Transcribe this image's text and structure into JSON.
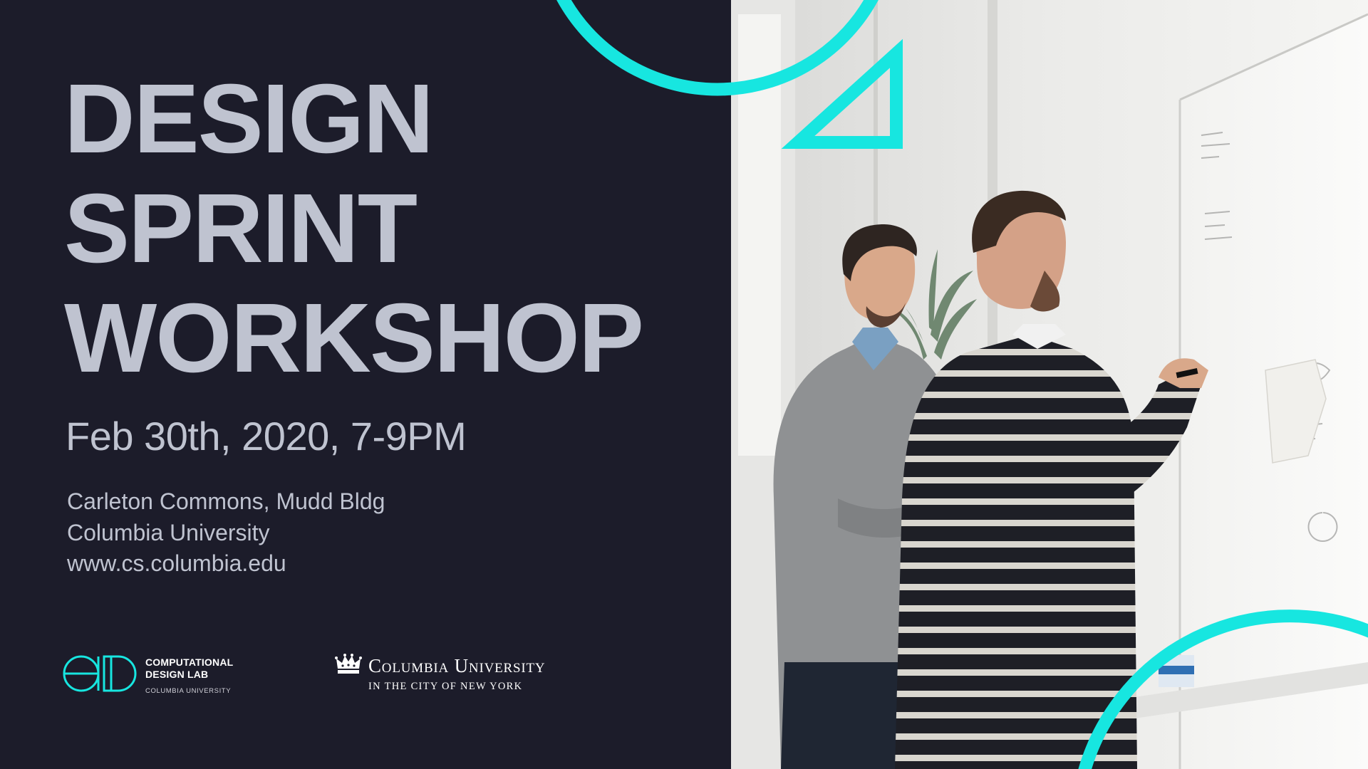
{
  "headline": {
    "line1": "DESIGN",
    "line2": "SPRINT",
    "line3": "WORKSHOP"
  },
  "event": {
    "date_time": "Feb 30th, 2020, 7-9PM",
    "venue_line1": "Carleton Commons, Mudd Bldg",
    "venue_line2": "Columbia University",
    "website": "www.cs.columbia.edu"
  },
  "logos": {
    "cdl": {
      "name_line1": "COMPUTATIONAL",
      "name_line2": "DESIGN LAB",
      "sub": "COLUMBIA UNIVERSITY"
    },
    "columbia": {
      "name": "Columbia University",
      "sub": "IN THE CITY OF NEW YORK"
    }
  },
  "photo": {
    "description_icon": "photo-two-men-at-whiteboard"
  },
  "colors": {
    "background": "#1c1c2a",
    "text": "#bfc3d0",
    "accent": "#17e6e0",
    "white": "#ffffff"
  }
}
